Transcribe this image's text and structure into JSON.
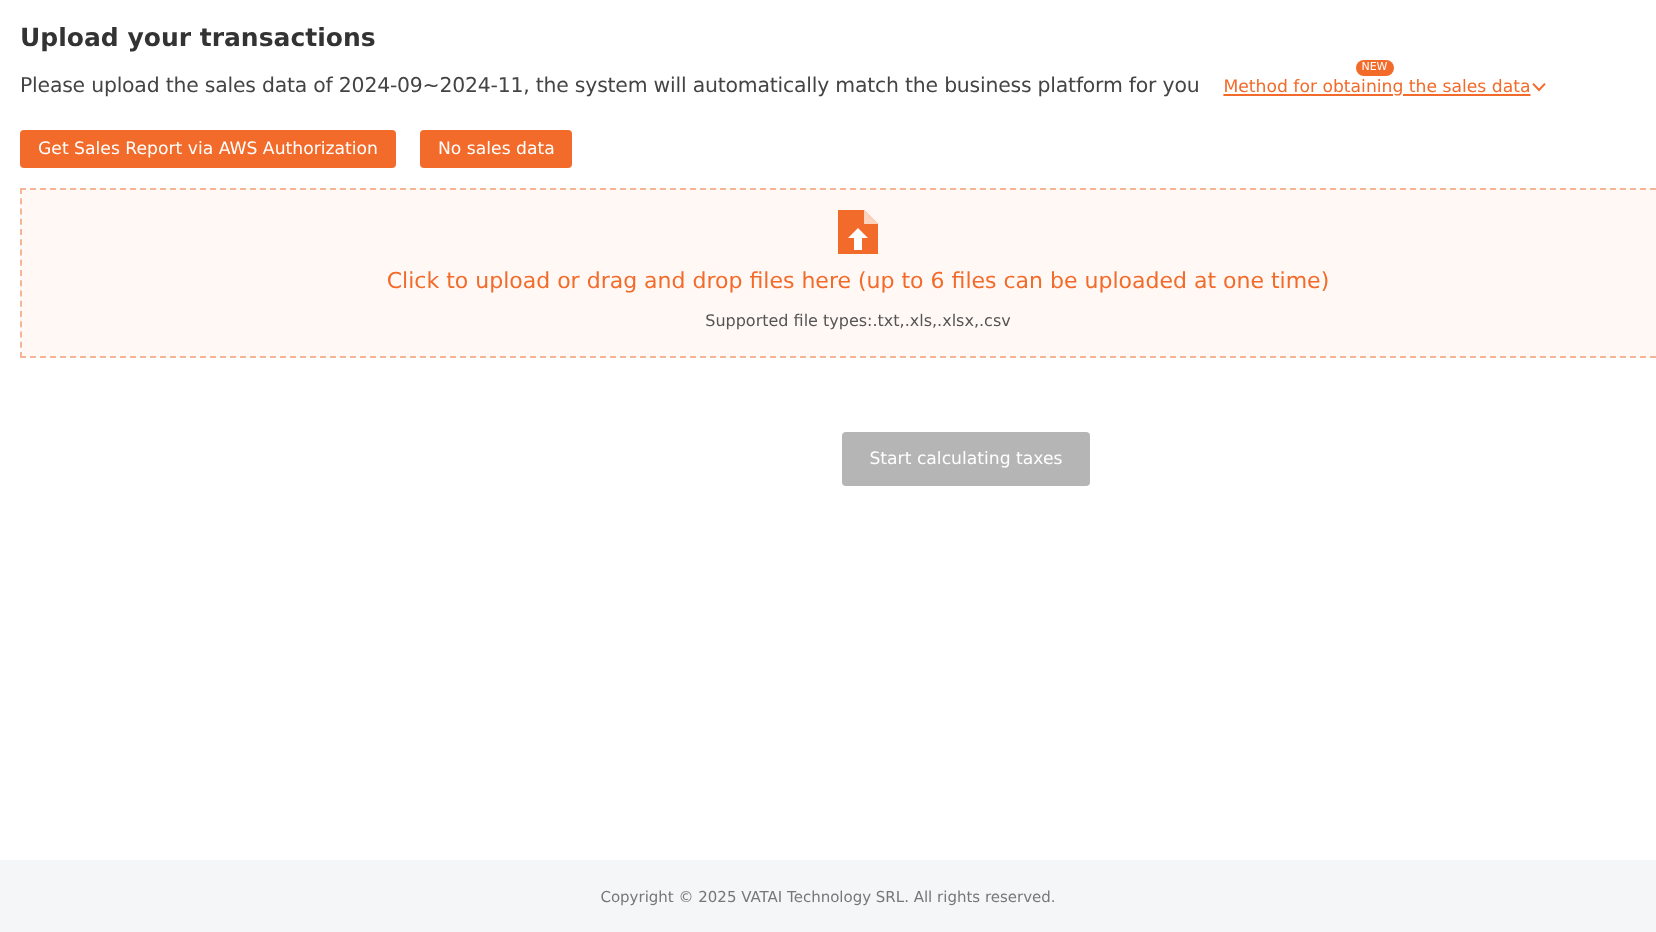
{
  "title": "Upload your transactions",
  "description": "Please upload the sales data of 2024-09~2024-11, the system will automatically match the business platform for you",
  "method_link": {
    "label": "Method for obtaining the sales data",
    "badge": "NEW",
    "expanded": false
  },
  "actions": [
    {
      "label": "Get Sales Report via AWS Authorization"
    },
    {
      "label": "No sales data"
    }
  ],
  "upload": {
    "prompt": "Click to upload or drag and drop files here (up to 6 files can be uploaded at one time)",
    "hint": "Supported file types:.txt,.xls,.xlsx,.csv"
  },
  "start_button": {
    "label": "Start calculating taxes",
    "disabled": true
  },
  "footer": "Copyright © 2025 VATAI Technology SRL. All rights reserved."
}
